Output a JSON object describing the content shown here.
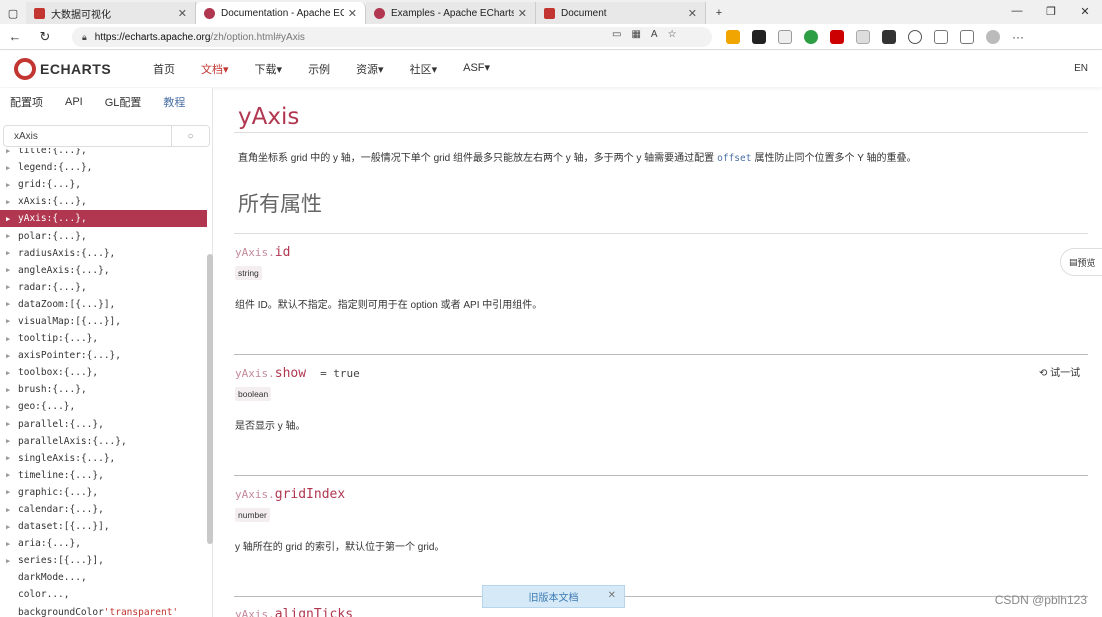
{
  "browser": {
    "tabs": [
      {
        "title": "大数据可视化",
        "favicon_color": "#c23531"
      },
      {
        "title": "Documentation - Apache ECharts",
        "favicon_color": "#b13750",
        "active": true
      },
      {
        "title": "Examples - Apache ECharts",
        "favicon_color": "#b13750"
      },
      {
        "title": "Document",
        "favicon_color": "#c23531"
      }
    ],
    "new_tab": "+",
    "url_host": "https://echarts.apache.org",
    "url_path": "/zh/option.html#yAxis"
  },
  "site": {
    "logo": "ECHARTS",
    "nav": [
      {
        "label": "首页"
      },
      {
        "label": "文档▾",
        "active": true
      },
      {
        "label": "下载▾"
      },
      {
        "label": "示例"
      },
      {
        "label": "资源▾"
      },
      {
        "label": "社区▾"
      },
      {
        "label": "ASF▾"
      }
    ],
    "lang": "EN"
  },
  "sidebar": {
    "tabs": [
      "配置项",
      "API",
      "GL配置",
      "教程"
    ],
    "search_value": "xAxis",
    "items": [
      {
        "key": "title",
        "val": "{...}"
      },
      {
        "key": "legend",
        "val": "{...}"
      },
      {
        "key": "grid",
        "val": "{...}"
      },
      {
        "key": "xAxis",
        "val": "{...}"
      },
      {
        "key": "yAxis",
        "val": "{...}",
        "selected": true
      },
      {
        "key": "polar",
        "val": "{...}"
      },
      {
        "key": "radiusAxis",
        "val": "{...}"
      },
      {
        "key": "angleAxis",
        "val": "{...}"
      },
      {
        "key": "radar",
        "val": "{...}"
      },
      {
        "key": "dataZoom",
        "val": "[{...}]"
      },
      {
        "key": "visualMap",
        "val": "[{...}]"
      },
      {
        "key": "tooltip",
        "val": "{...}"
      },
      {
        "key": "axisPointer",
        "val": "{...}"
      },
      {
        "key": "toolbox",
        "val": "{...}"
      },
      {
        "key": "brush",
        "val": "{...}"
      },
      {
        "key": "geo",
        "val": "{...}"
      },
      {
        "key": "parallel",
        "val": "{...}"
      },
      {
        "key": "parallelAxis",
        "val": "{...}"
      },
      {
        "key": "singleAxis",
        "val": "{...}"
      },
      {
        "key": "timeline",
        "val": "{...}"
      },
      {
        "key": "graphic",
        "val": "{...}"
      },
      {
        "key": "calendar",
        "val": "{...}"
      },
      {
        "key": "dataset",
        "val": "[{...}]"
      },
      {
        "key": "aria",
        "val": "{...}"
      },
      {
        "key": "series",
        "val": "[{...}]"
      },
      {
        "key": "darkMode",
        "val": "...",
        "leaf": true
      },
      {
        "key": "color",
        "val": "...",
        "leaf": true
      },
      {
        "key": "backgroundColor",
        "val": "'transparent'",
        "leaf": true,
        "string": true
      }
    ]
  },
  "content": {
    "title": "yAxis",
    "desc_before": "直角坐标系 grid 中的 y 轴，一般情况下单个 grid 组件最多只能放左右两个 y 轴，多于两个 y 轴需要通过配置",
    "desc_code": "offset",
    "desc_after": "属性防止同个位置多个 Y 轴的重叠。",
    "all_attrs": "所有属性",
    "prefix": "yAxis.",
    "props": [
      {
        "name": "id",
        "type": "string",
        "desc": "组件 ID。默认不指定。指定则可用于在 option 或者 API 中引用组件。"
      },
      {
        "name": "show",
        "default": "= true",
        "type": "boolean",
        "desc": "是否显示 y 轴。"
      },
      {
        "name": "gridIndex",
        "type": "number",
        "desc": "y 轴所在的 grid 的索引，默认位于第一个 grid。"
      },
      {
        "name": "alignTicks"
      }
    ],
    "try_label": "试一试",
    "preview_label": "预览"
  },
  "old_docs": "旧版本文档",
  "watermark": "CSDN @pblh123"
}
